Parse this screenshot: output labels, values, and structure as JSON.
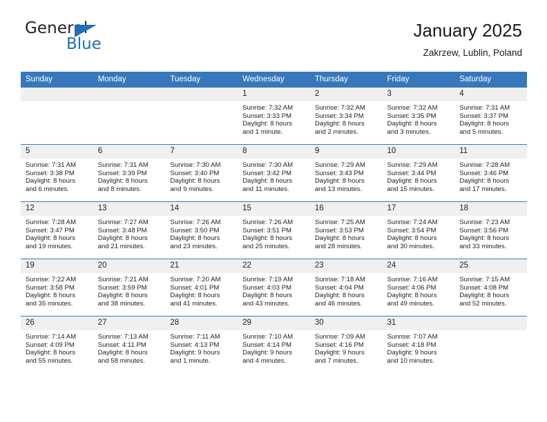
{
  "brand": {
    "name_part1": "General",
    "name_part2": "Blue",
    "triangle_color": "#1c70bd",
    "text_color": "#231f20"
  },
  "header": {
    "title": "January 2025",
    "subtitle": "Zakrzew, Lublin, Poland"
  },
  "theme": {
    "header_bg": "#3778bc",
    "header_text": "#ffffff",
    "daynum_bg": "#f0f0f0",
    "cell_border": "#3778bc"
  },
  "weekdays": [
    "Sunday",
    "Monday",
    "Tuesday",
    "Wednesday",
    "Thursday",
    "Friday",
    "Saturday"
  ],
  "weeks": [
    [
      {
        "day": "",
        "sunrise": "",
        "sunset": "",
        "daylight1": "",
        "daylight2": ""
      },
      {
        "day": "",
        "sunrise": "",
        "sunset": "",
        "daylight1": "",
        "daylight2": ""
      },
      {
        "day": "",
        "sunrise": "",
        "sunset": "",
        "daylight1": "",
        "daylight2": ""
      },
      {
        "day": "1",
        "sunrise": "Sunrise: 7:32 AM",
        "sunset": "Sunset: 3:33 PM",
        "daylight1": "Daylight: 8 hours",
        "daylight2": "and 1 minute."
      },
      {
        "day": "2",
        "sunrise": "Sunrise: 7:32 AM",
        "sunset": "Sunset: 3:34 PM",
        "daylight1": "Daylight: 8 hours",
        "daylight2": "and 2 minutes."
      },
      {
        "day": "3",
        "sunrise": "Sunrise: 7:32 AM",
        "sunset": "Sunset: 3:35 PM",
        "daylight1": "Daylight: 8 hours",
        "daylight2": "and 3 minutes."
      },
      {
        "day": "4",
        "sunrise": "Sunrise: 7:31 AM",
        "sunset": "Sunset: 3:37 PM",
        "daylight1": "Daylight: 8 hours",
        "daylight2": "and 5 minutes."
      }
    ],
    [
      {
        "day": "5",
        "sunrise": "Sunrise: 7:31 AM",
        "sunset": "Sunset: 3:38 PM",
        "daylight1": "Daylight: 8 hours",
        "daylight2": "and 6 minutes."
      },
      {
        "day": "6",
        "sunrise": "Sunrise: 7:31 AM",
        "sunset": "Sunset: 3:39 PM",
        "daylight1": "Daylight: 8 hours",
        "daylight2": "and 8 minutes."
      },
      {
        "day": "7",
        "sunrise": "Sunrise: 7:30 AM",
        "sunset": "Sunset: 3:40 PM",
        "daylight1": "Daylight: 8 hours",
        "daylight2": "and 9 minutes."
      },
      {
        "day": "8",
        "sunrise": "Sunrise: 7:30 AM",
        "sunset": "Sunset: 3:42 PM",
        "daylight1": "Daylight: 8 hours",
        "daylight2": "and 11 minutes."
      },
      {
        "day": "9",
        "sunrise": "Sunrise: 7:29 AM",
        "sunset": "Sunset: 3:43 PM",
        "daylight1": "Daylight: 8 hours",
        "daylight2": "and 13 minutes."
      },
      {
        "day": "10",
        "sunrise": "Sunrise: 7:29 AM",
        "sunset": "Sunset: 3:44 PM",
        "daylight1": "Daylight: 8 hours",
        "daylight2": "and 15 minutes."
      },
      {
        "day": "11",
        "sunrise": "Sunrise: 7:28 AM",
        "sunset": "Sunset: 3:46 PM",
        "daylight1": "Daylight: 8 hours",
        "daylight2": "and 17 minutes."
      }
    ],
    [
      {
        "day": "12",
        "sunrise": "Sunrise: 7:28 AM",
        "sunset": "Sunset: 3:47 PM",
        "daylight1": "Daylight: 8 hours",
        "daylight2": "and 19 minutes."
      },
      {
        "day": "13",
        "sunrise": "Sunrise: 7:27 AM",
        "sunset": "Sunset: 3:48 PM",
        "daylight1": "Daylight: 8 hours",
        "daylight2": "and 21 minutes."
      },
      {
        "day": "14",
        "sunrise": "Sunrise: 7:26 AM",
        "sunset": "Sunset: 3:50 PM",
        "daylight1": "Daylight: 8 hours",
        "daylight2": "and 23 minutes."
      },
      {
        "day": "15",
        "sunrise": "Sunrise: 7:26 AM",
        "sunset": "Sunset: 3:51 PM",
        "daylight1": "Daylight: 8 hours",
        "daylight2": "and 25 minutes."
      },
      {
        "day": "16",
        "sunrise": "Sunrise: 7:25 AM",
        "sunset": "Sunset: 3:53 PM",
        "daylight1": "Daylight: 8 hours",
        "daylight2": "and 28 minutes."
      },
      {
        "day": "17",
        "sunrise": "Sunrise: 7:24 AM",
        "sunset": "Sunset: 3:54 PM",
        "daylight1": "Daylight: 8 hours",
        "daylight2": "and 30 minutes."
      },
      {
        "day": "18",
        "sunrise": "Sunrise: 7:23 AM",
        "sunset": "Sunset: 3:56 PM",
        "daylight1": "Daylight: 8 hours",
        "daylight2": "and 33 minutes."
      }
    ],
    [
      {
        "day": "19",
        "sunrise": "Sunrise: 7:22 AM",
        "sunset": "Sunset: 3:58 PM",
        "daylight1": "Daylight: 8 hours",
        "daylight2": "and 35 minutes."
      },
      {
        "day": "20",
        "sunrise": "Sunrise: 7:21 AM",
        "sunset": "Sunset: 3:59 PM",
        "daylight1": "Daylight: 8 hours",
        "daylight2": "and 38 minutes."
      },
      {
        "day": "21",
        "sunrise": "Sunrise: 7:20 AM",
        "sunset": "Sunset: 4:01 PM",
        "daylight1": "Daylight: 8 hours",
        "daylight2": "and 41 minutes."
      },
      {
        "day": "22",
        "sunrise": "Sunrise: 7:19 AM",
        "sunset": "Sunset: 4:03 PM",
        "daylight1": "Daylight: 8 hours",
        "daylight2": "and 43 minutes."
      },
      {
        "day": "23",
        "sunrise": "Sunrise: 7:18 AM",
        "sunset": "Sunset: 4:04 PM",
        "daylight1": "Daylight: 8 hours",
        "daylight2": "and 46 minutes."
      },
      {
        "day": "24",
        "sunrise": "Sunrise: 7:16 AM",
        "sunset": "Sunset: 4:06 PM",
        "daylight1": "Daylight: 8 hours",
        "daylight2": "and 49 minutes."
      },
      {
        "day": "25",
        "sunrise": "Sunrise: 7:15 AM",
        "sunset": "Sunset: 4:08 PM",
        "daylight1": "Daylight: 8 hours",
        "daylight2": "and 52 minutes."
      }
    ],
    [
      {
        "day": "26",
        "sunrise": "Sunrise: 7:14 AM",
        "sunset": "Sunset: 4:09 PM",
        "daylight1": "Daylight: 8 hours",
        "daylight2": "and 55 minutes."
      },
      {
        "day": "27",
        "sunrise": "Sunrise: 7:13 AM",
        "sunset": "Sunset: 4:11 PM",
        "daylight1": "Daylight: 8 hours",
        "daylight2": "and 58 minutes."
      },
      {
        "day": "28",
        "sunrise": "Sunrise: 7:11 AM",
        "sunset": "Sunset: 4:13 PM",
        "daylight1": "Daylight: 9 hours",
        "daylight2": "and 1 minute."
      },
      {
        "day": "29",
        "sunrise": "Sunrise: 7:10 AM",
        "sunset": "Sunset: 4:14 PM",
        "daylight1": "Daylight: 9 hours",
        "daylight2": "and 4 minutes."
      },
      {
        "day": "30",
        "sunrise": "Sunrise: 7:09 AM",
        "sunset": "Sunset: 4:16 PM",
        "daylight1": "Daylight: 9 hours",
        "daylight2": "and 7 minutes."
      },
      {
        "day": "31",
        "sunrise": "Sunrise: 7:07 AM",
        "sunset": "Sunset: 4:18 PM",
        "daylight1": "Daylight: 9 hours",
        "daylight2": "and 10 minutes."
      },
      {
        "day": "",
        "sunrise": "",
        "sunset": "",
        "daylight1": "",
        "daylight2": ""
      }
    ]
  ]
}
